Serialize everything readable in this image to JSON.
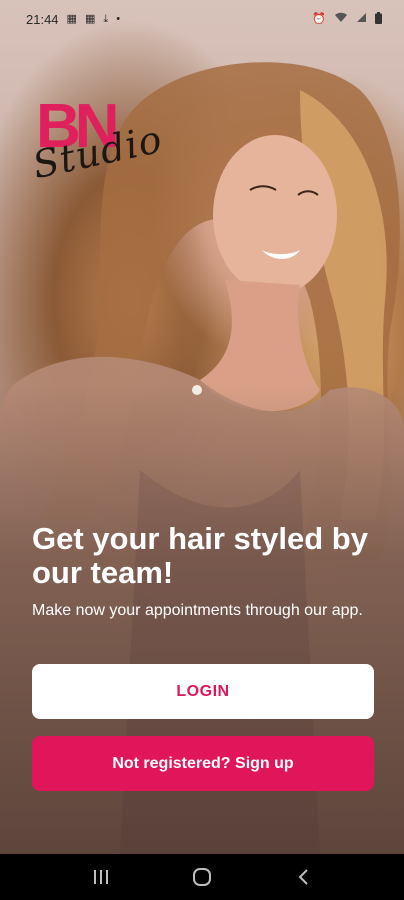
{
  "status_bar": {
    "time": "21:44",
    "notification_icons": [
      "image-icon",
      "image-icon",
      "download-icon",
      "dot-icon"
    ],
    "system_icons": [
      "alarm-icon",
      "wifi-icon",
      "signal-icon",
      "battery-icon"
    ]
  },
  "logo": {
    "letters": "BN",
    "script": "Studio"
  },
  "main": {
    "headline": "Get your hair styled by our team!",
    "subtext": "Make now your appointments through our app."
  },
  "buttons": {
    "login_label": "LOGIN",
    "signup_label": "Not registered? Sign up"
  },
  "nav_bar": {
    "items": [
      "recent-apps-icon",
      "home-icon",
      "back-icon"
    ]
  },
  "colors": {
    "accent": "#e0155a",
    "headline_text": "#ffffff",
    "nav_background": "#000000"
  }
}
